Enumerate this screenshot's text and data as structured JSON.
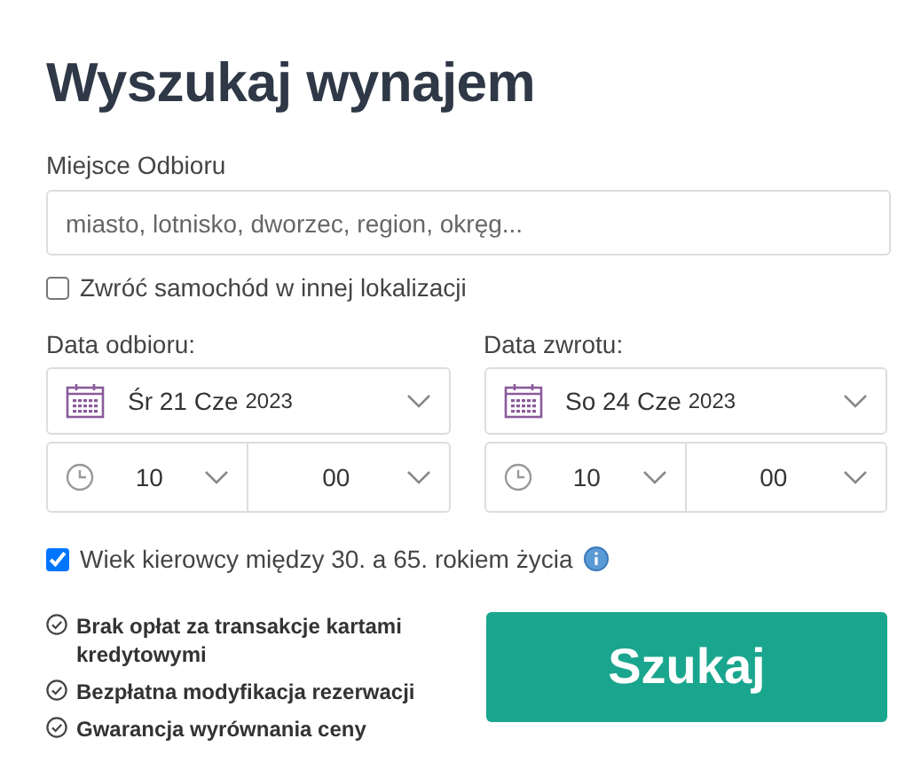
{
  "title": "Wyszukaj wynajem",
  "pickup": {
    "label": "Miejsce Odbioru",
    "placeholder": "miasto, lotnisko, dworzec, region, okręg..."
  },
  "return_elsewhere": {
    "label": "Zwróć samochód w innej lokalizacji",
    "checked": false
  },
  "dates": [
    {
      "label": "Data odbioru:",
      "date": "Śr 21 Cze",
      "year": "2023",
      "hour": "10",
      "minute": "00"
    },
    {
      "label": "Data zwrotu:",
      "date": "So 24 Cze",
      "year": "2023",
      "hour": "10",
      "minute": "00"
    }
  ],
  "driver_age": {
    "label": "Wiek kierowcy między 30. a 65. rokiem życia",
    "checked": true
  },
  "features": [
    "Brak opłat za transakcje kartami kredytowymi",
    "Bezpłatna modyfikacja rezerwacji",
    "Gwarancja wyrównania ceny"
  ],
  "search_button": "Szukaj"
}
